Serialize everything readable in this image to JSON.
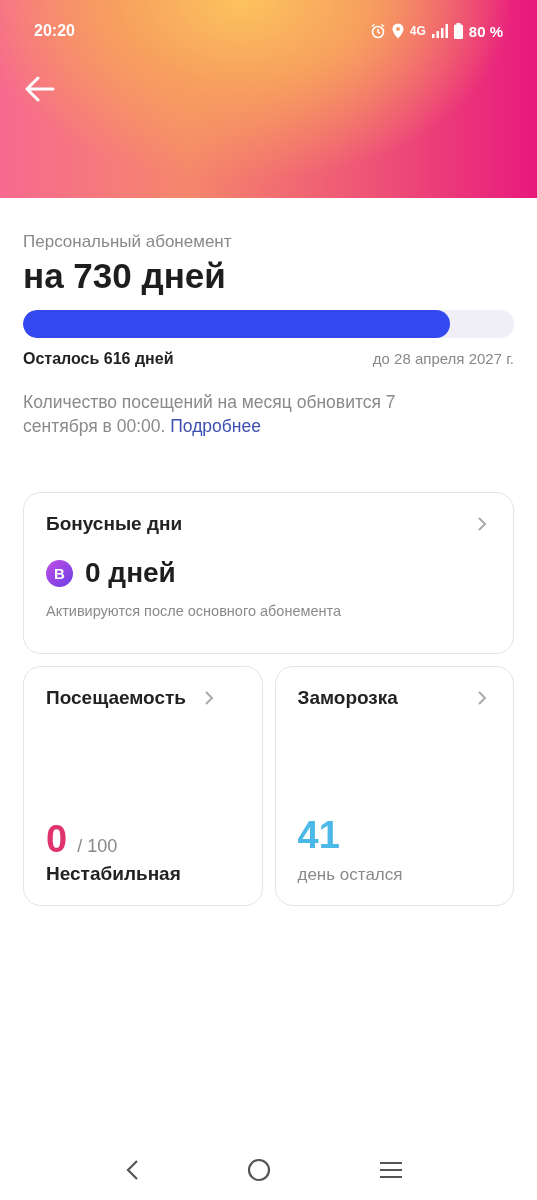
{
  "status_bar": {
    "time": "20:20",
    "network": "4G",
    "battery": "80 %"
  },
  "subscription": {
    "caption": "Персональный абонемент",
    "title": "на 730 дней",
    "level": 0.87,
    "remaining": "Осталось 616 дней",
    "until": "до 28 апреля 2027 г.",
    "note": "Количество посещений на месяц обновится 7 сентября в 00:00.",
    "link": "Подробнее"
  },
  "bonus_card": {
    "title": "Бонусные дни",
    "badge": "B",
    "value": "0 дней",
    "hint": "Активируются после основного абонемента"
  },
  "stat_cards": [
    {
      "title": "Посещаемость",
      "value": "0",
      "color": "#e0336b",
      "suffix": "/ 100",
      "caption": "Нестабильная",
      "kind": "score"
    },
    {
      "title": "Заморозка",
      "value": "41",
      "color": "#4bb8e8",
      "caption": "день остался",
      "kind": "counter"
    }
  ]
}
